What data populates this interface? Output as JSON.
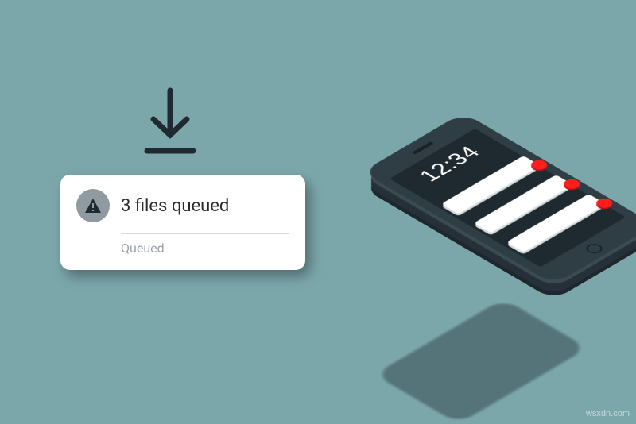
{
  "notification": {
    "title": "3 files queued",
    "status": "Queued",
    "icon": "alert-triangle-icon"
  },
  "phone": {
    "time": "12:34",
    "notifications": [
      {
        "badge": true
      },
      {
        "badge": true
      },
      {
        "badge": true
      }
    ]
  },
  "colors": {
    "background": "#7ba7ab",
    "phone_body": "#2f3d45",
    "badge": "#ff1e1e"
  },
  "watermark": "wsxdn.com"
}
